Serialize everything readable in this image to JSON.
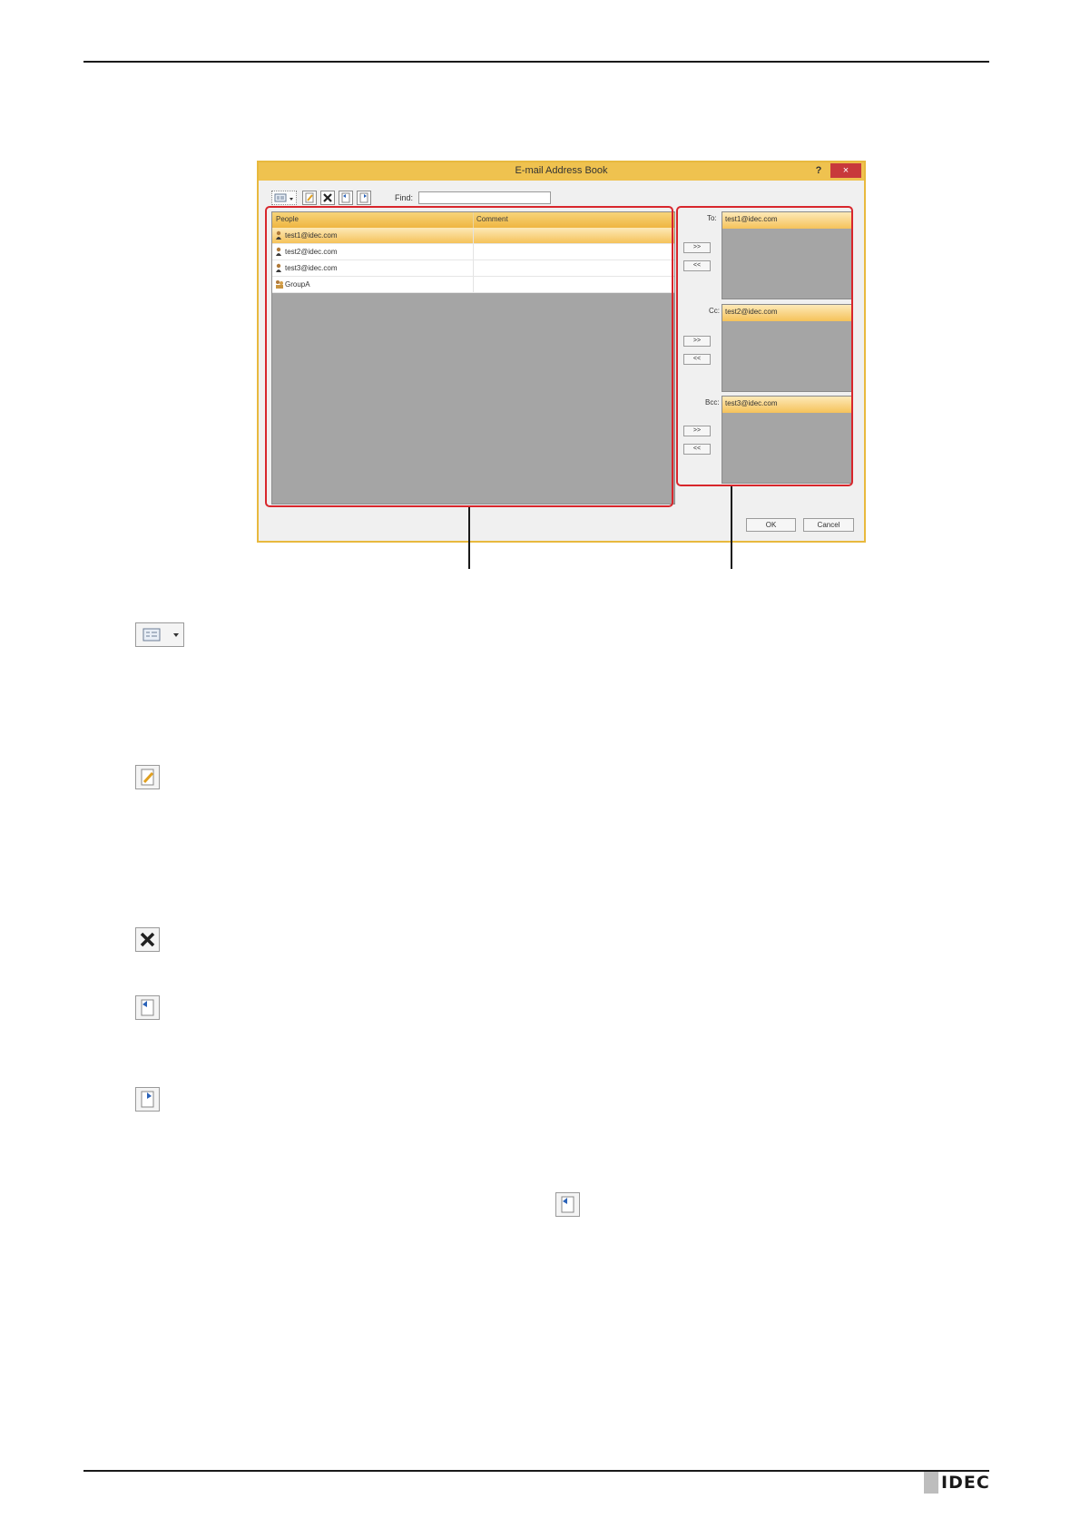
{
  "dialog": {
    "title": "E-mail Address Book",
    "help_label": "?",
    "close_label": "×",
    "find_label": "Find:",
    "find_value": "",
    "columns": [
      "People",
      "Comment"
    ],
    "people": [
      {
        "name": "test1@idec.com",
        "comment": "",
        "type": "person",
        "selected": true
      },
      {
        "name": "test2@idec.com",
        "comment": "",
        "type": "person",
        "selected": false
      },
      {
        "name": "test3@idec.com",
        "comment": "",
        "type": "person",
        "selected": false
      },
      {
        "name": "GroupA",
        "comment": "",
        "type": "group",
        "selected": false
      }
    ],
    "recipients": {
      "to": {
        "label": "To:",
        "entries": [
          "test1@idec.com"
        ]
      },
      "cc": {
        "label": "Cc:",
        "entries": [
          "test2@idec.com"
        ]
      },
      "bcc": {
        "label": "Bcc:",
        "entries": [
          "test3@idec.com"
        ]
      }
    },
    "add_label": ">>",
    "remove_label": "<<",
    "ok_label": "OK",
    "cancel_label": "Cancel"
  },
  "colors": {
    "title_bar": "#efc24f",
    "highlight": "#d8262c",
    "selection": "#f5c25a",
    "close_button": "#c8393b"
  },
  "icons": [
    "view-icon",
    "edit-icon",
    "delete-icon",
    "import-icon",
    "export-icon",
    "import-icon"
  ],
  "footer": {
    "logo": "IDEC"
  }
}
